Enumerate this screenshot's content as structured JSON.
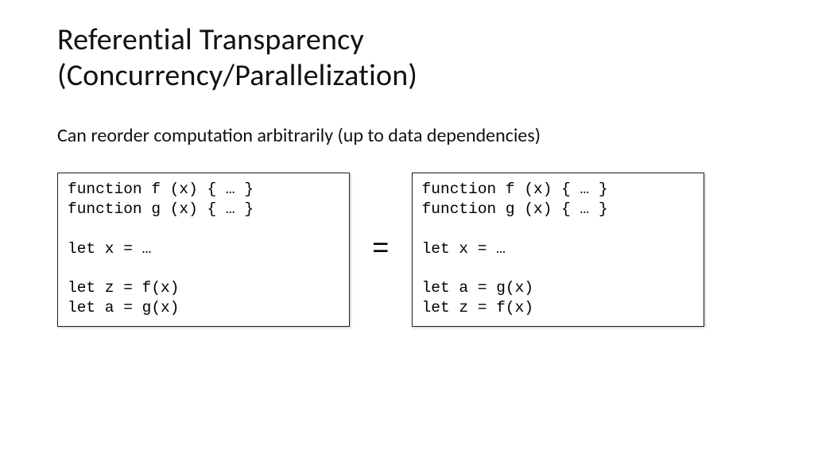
{
  "title_line1": "Referential Transparency",
  "title_line2": "(Concurrency/Parallelization)",
  "subtitle": "Can reorder computation arbitrarily (up to data dependencies)",
  "equals": "=",
  "code_left": "function f (x) { … }\nfunction g (x) { … }\n\nlet x = …\n\nlet z = f(x)\nlet a = g(x)",
  "code_right": "function f (x) { … }\nfunction g (x) { … }\n\nlet x = …\n\nlet a = g(x)\nlet z = f(x)"
}
